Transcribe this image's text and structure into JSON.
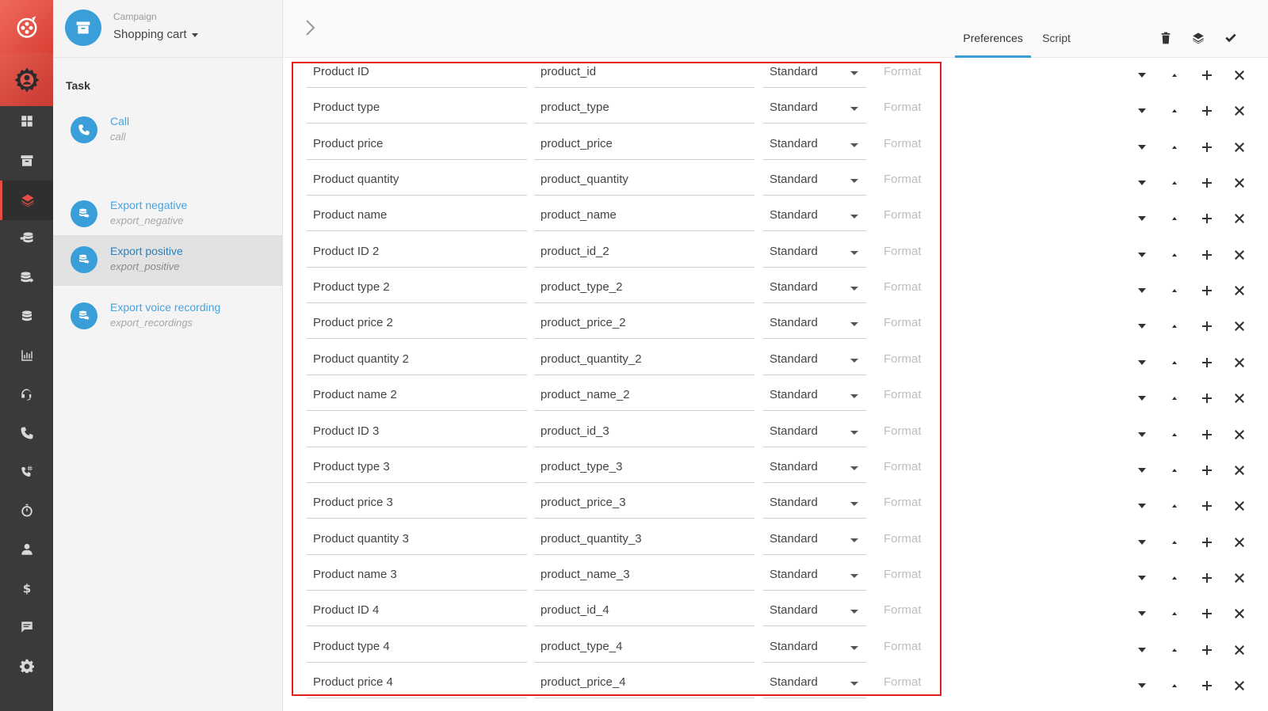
{
  "campaign": {
    "label": "Campaign",
    "name": "Shopping cart"
  },
  "task_panel": {
    "title": "Task",
    "items": [
      {
        "name": "Call",
        "key": "call",
        "icon": "phone-icon"
      },
      {
        "name": "Export negative",
        "key": "export_negative",
        "icon": "export-icon"
      },
      {
        "name": "Export positive",
        "key": "export_positive",
        "icon": "export-icon",
        "selected": true
      },
      {
        "name": "Export voice recording",
        "key": "export_recordings",
        "icon": "export-icon"
      }
    ]
  },
  "tabs": {
    "preferences": "Preferences",
    "script": "Script"
  },
  "rows": [
    {
      "label": "Product ID",
      "key": "product_id",
      "type": "Standard",
      "format": "Format"
    },
    {
      "label": "Product type",
      "key": "product_type",
      "type": "Standard",
      "format": "Format"
    },
    {
      "label": "Product price",
      "key": "product_price",
      "type": "Standard",
      "format": "Format"
    },
    {
      "label": "Product quantity",
      "key": "product_quantity",
      "type": "Standard",
      "format": "Format"
    },
    {
      "label": "Product name",
      "key": "product_name",
      "type": "Standard",
      "format": "Format"
    },
    {
      "label": "Product ID 2",
      "key": "product_id_2",
      "type": "Standard",
      "format": "Format"
    },
    {
      "label": "Product type 2",
      "key": "product_type_2",
      "type": "Standard",
      "format": "Format"
    },
    {
      "label": "Product price 2",
      "key": "product_price_2",
      "type": "Standard",
      "format": "Format"
    },
    {
      "label": "Product quantity 2",
      "key": "product_quantity_2",
      "type": "Standard",
      "format": "Format"
    },
    {
      "label": "Product name 2",
      "key": "product_name_2",
      "type": "Standard",
      "format": "Format"
    },
    {
      "label": "Product ID 3",
      "key": "product_id_3",
      "type": "Standard",
      "format": "Format"
    },
    {
      "label": "Product type 3",
      "key": "product_type_3",
      "type": "Standard",
      "format": "Format"
    },
    {
      "label": "Product price 3",
      "key": "product_price_3",
      "type": "Standard",
      "format": "Format"
    },
    {
      "label": "Product quantity 3",
      "key": "product_quantity_3",
      "type": "Standard",
      "format": "Format"
    },
    {
      "label": "Product name 3",
      "key": "product_name_3",
      "type": "Standard",
      "format": "Format"
    },
    {
      "label": "Product ID 4",
      "key": "product_id_4",
      "type": "Standard",
      "format": "Format"
    },
    {
      "label": "Product type 4",
      "key": "product_type_4",
      "type": "Standard",
      "format": "Format"
    },
    {
      "label": "Product price 4",
      "key": "product_price_4",
      "type": "Standard",
      "format": "Format"
    }
  ],
  "colors": {
    "accent": "#3a9ed8",
    "brand": "#e64e45",
    "highlight": "#e21d1d",
    "rail": "#3a3a3a"
  }
}
